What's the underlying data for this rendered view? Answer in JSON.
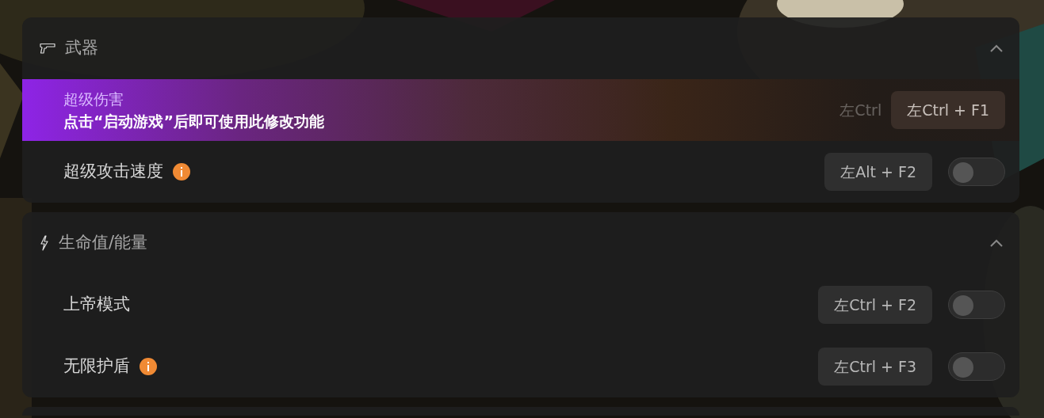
{
  "sections": [
    {
      "title": "武器",
      "expanded": true,
      "items": [
        {
          "kind": "banner",
          "title": "超级伤害",
          "message": "点击“启动游戏”后即可使用此修改功能",
          "ghost_hotkey": "左Ctrl",
          "hotkey": "左Ctrl + F1"
        },
        {
          "kind": "toggle",
          "label": "超级攻击速度",
          "info": true,
          "hotkey": "左Alt + F2",
          "on": false
        }
      ]
    },
    {
      "title": "生命值/能量",
      "expanded": true,
      "items": [
        {
          "kind": "toggle",
          "label": "上帝模式",
          "info": false,
          "hotkey": "左Ctrl + F2",
          "on": false
        },
        {
          "kind": "toggle",
          "label": "无限护盾",
          "info": true,
          "hotkey": "左Ctrl + F3",
          "on": false
        }
      ]
    }
  ]
}
